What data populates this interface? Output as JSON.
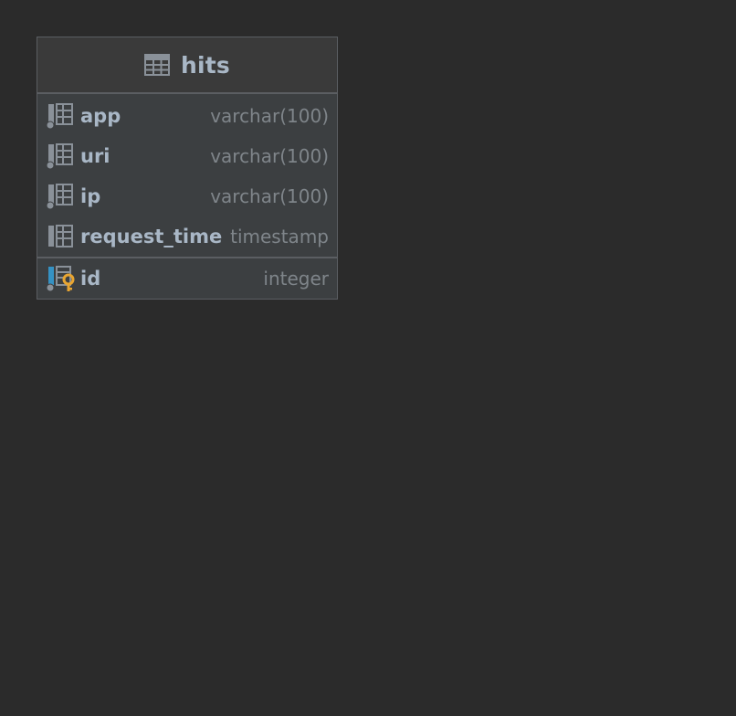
{
  "table": {
    "name": "hits",
    "icon": "table-icon",
    "columns": [
      {
        "name": "app",
        "type": "varchar(100)",
        "icon": "nullable-column-icon"
      },
      {
        "name": "uri",
        "type": "varchar(100)",
        "icon": "nullable-column-icon"
      },
      {
        "name": "ip",
        "type": "varchar(100)",
        "icon": "nullable-column-icon"
      },
      {
        "name": "request_time",
        "type": "timestamp",
        "icon": "column-icon"
      }
    ],
    "key_columns": [
      {
        "name": "id",
        "type": "integer",
        "icon": "primary-key-column-icon"
      }
    ]
  },
  "colors": {
    "background": "#2b2b2b",
    "card": "#3c3f41",
    "border": "#5b5e62",
    "name_text": "#a9b7c6",
    "type_text": "#7f858a",
    "key_gold": "#e8a531",
    "key_blue": "#3592c4"
  }
}
